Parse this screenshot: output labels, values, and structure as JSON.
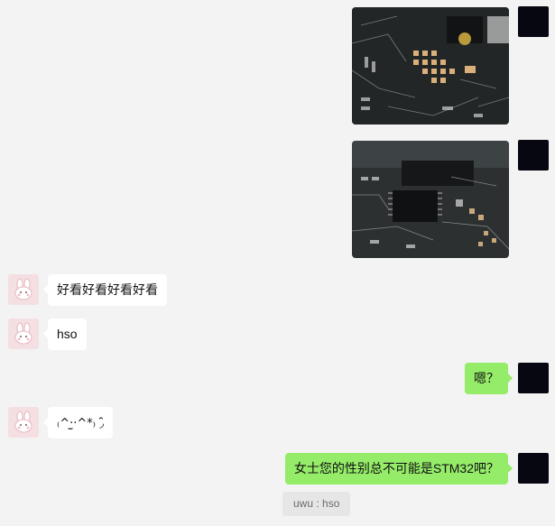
{
  "messages": [
    {
      "id": "m1",
      "side": "right",
      "type": "image",
      "image_icon": "circuit-board-photo-icon"
    },
    {
      "id": "m2",
      "side": "right",
      "type": "image",
      "image_icon": "circuit-board-chip-photo-icon"
    },
    {
      "id": "m3",
      "side": "left",
      "type": "text",
      "text": "好看好看好看好看"
    },
    {
      "id": "m4",
      "side": "left",
      "type": "text",
      "text": "hso"
    },
    {
      "id": "m5",
      "side": "right",
      "type": "text",
      "text": "嗯？"
    },
    {
      "id": "m6",
      "side": "left",
      "type": "text",
      "text": "₍^·̫·^*₎ ◞̑̑"
    },
    {
      "id": "m7",
      "side": "right",
      "type": "text",
      "text": "女士您的性别总不可能是STM32吧？"
    }
  ],
  "quote": {
    "text": "uwu : hso"
  },
  "avatars": {
    "self_icon": "black-square-avatar-icon",
    "other_icon": "white-bunny-avatar-icon",
    "other_bg": "#f4dfe2",
    "self_bg": "#070712"
  },
  "colors": {
    "background": "#f3f3f3",
    "bubble_self": "#95ec69",
    "bubble_other": "#ffffff",
    "quote_bg": "#e6e6e6"
  }
}
